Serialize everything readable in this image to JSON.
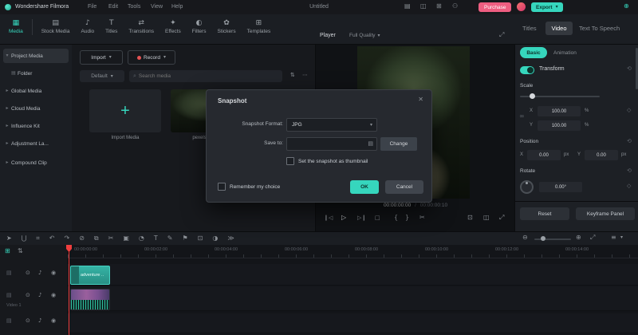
{
  "colors": {
    "accent": "#36d6bd",
    "purchase": "#ef5e81",
    "playhead": "#f03e3e"
  },
  "titlebar": {
    "app_name": "Wondershare Filmora",
    "menus": [
      "File",
      "Edit",
      "Tools",
      "View",
      "Help"
    ],
    "project_title": "Untitled",
    "purchase_label": "Purchase",
    "export_label": "Export",
    "export_caret": "▾",
    "icons": [
      {
        "name": "workspace-icon",
        "glyph": "▤"
      },
      {
        "name": "display-icon",
        "glyph": "◫"
      },
      {
        "name": "grid-icon",
        "glyph": "⊞"
      },
      {
        "name": "account-icon",
        "glyph": "⚇"
      }
    ],
    "add_icon": "⊕"
  },
  "ribbon": {
    "tabs": [
      {
        "label": "Media",
        "icon": "▦"
      },
      {
        "label": "Stock Media",
        "icon": "▤"
      },
      {
        "label": "Audio",
        "icon": "♪"
      },
      {
        "label": "Titles",
        "icon": "T"
      },
      {
        "label": "Transitions",
        "icon": "⇄"
      },
      {
        "label": "Effects",
        "icon": "✦"
      },
      {
        "label": "Filters",
        "icon": "◐"
      },
      {
        "label": "Stickers",
        "icon": "✿"
      },
      {
        "label": "Templates",
        "icon": "⊞"
      }
    ],
    "active_tab": "Media"
  },
  "sidebar": {
    "items": [
      {
        "label": "Project Media",
        "chevron": "▾"
      },
      {
        "label": "Folder",
        "chevron": ""
      },
      {
        "label": "Global Media",
        "chevron": "▸"
      },
      {
        "label": "Cloud Media",
        "chevron": "▸"
      },
      {
        "label": "Influence Kit",
        "chevron": "▸"
      },
      {
        "label": "Adjustment La...",
        "chevron": "▸"
      },
      {
        "label": "Compound Clip",
        "chevron": "▸"
      }
    ]
  },
  "media_panel": {
    "import_label": "Import",
    "record_label": "Record",
    "default_label": "Default",
    "caret": "▾",
    "search_placeholder": "Search media",
    "search_icon": "⌕",
    "sort_icon": "⇅",
    "more_icon": "⋯",
    "import_tile_plus": "+",
    "import_tile_label": "Import Media",
    "clip_label": "pexels-josh..."
  },
  "player": {
    "label": "Player",
    "quality": "Full Quality",
    "quality_caret": "▾",
    "expand_icon": "⤢",
    "timecode_current": "00:00:00:00",
    "timecode_divider": "/",
    "timecode_total": "00:00:00:10",
    "transport": [
      {
        "name": "skip-back",
        "glyph": "❙◁"
      },
      {
        "name": "play",
        "glyph": "▷"
      },
      {
        "name": "skip-forward",
        "glyph": "▷❙"
      },
      {
        "name": "stop",
        "glyph": "□"
      },
      {
        "name": "mark-in",
        "glyph": "{"
      },
      {
        "name": "mark-out",
        "glyph": "}"
      },
      {
        "name": "split",
        "glyph": "✂"
      },
      {
        "name": "snapshot",
        "glyph": "⊡"
      },
      {
        "name": "pip",
        "glyph": "◫"
      },
      {
        "name": "fullscreen",
        "glyph": "⤢"
      }
    ]
  },
  "dialog": {
    "title": "Snapshot",
    "close_icon": "✕",
    "format_label": "Snapshot Format:",
    "format_value": "JPG",
    "format_caret": "▾",
    "save_label": "Save to:",
    "save_value": "",
    "folder_icon": "▤",
    "change_label": "Change",
    "thumbnail_checkbox_label": "Set the snapshot as thumbnail",
    "thumbnail_checked": false,
    "remember_checkbox_label": "Remember my choice",
    "remember_checked": false,
    "ok_label": "OK",
    "cancel_label": "Cancel"
  },
  "properties": {
    "tabs": [
      "Titles",
      "Video",
      "Text To Speech"
    ],
    "active_tab": "Video",
    "subtabs": [
      "Basic",
      "Animation"
    ],
    "transform_label": "Transform",
    "section_reset_icon": "⟲",
    "keyframe_icon": "◇",
    "link_icon": "∞",
    "scale": {
      "label": "Scale",
      "x_label": "X",
      "x_value": "100.00",
      "y_label": "Y",
      "y_value": "100.00",
      "unit": "%"
    },
    "position": {
      "label": "Position",
      "x_label": "X",
      "x_value": "0.00",
      "y_label": "Y",
      "y_value": "0.00",
      "unit": "px"
    },
    "rotate": {
      "label": "Rotate",
      "value": "0.00°"
    },
    "reset_label": "Reset",
    "keyframe_panel_label": "Keyframe Panel"
  },
  "toolbar": {
    "icons": [
      {
        "name": "select",
        "glyph": "➤"
      },
      {
        "name": "magnet",
        "glyph": "⋃"
      },
      {
        "name": "snap",
        "glyph": "⌗"
      },
      {
        "name": "undo",
        "glyph": "↶"
      },
      {
        "name": "redo",
        "glyph": "↷"
      },
      {
        "name": "delete",
        "glyph": "⊘"
      },
      {
        "name": "duplicate",
        "glyph": "⧉"
      },
      {
        "name": "split",
        "glyph": "✂"
      },
      {
        "name": "crop",
        "glyph": "▣"
      },
      {
        "name": "speed",
        "glyph": "◔"
      },
      {
        "name": "text",
        "glyph": "T"
      },
      {
        "name": "pen",
        "glyph": "✎"
      },
      {
        "name": "marker",
        "glyph": "⚑"
      },
      {
        "name": "screen-record",
        "glyph": "⊡"
      },
      {
        "name": "chroma-key",
        "glyph": "◑"
      },
      {
        "name": "more-tools",
        "glyph": "≫"
      }
    ],
    "zoom_out_icon": "⊖",
    "zoom_in_icon": "⊕",
    "fit_icon": "⤢",
    "track_view_icon": "≡",
    "track_view_caret": "▾"
  },
  "timeline": {
    "manage_tracks_icon": "⊞",
    "mixer_icon": "⇅",
    "ruler": [
      "00:00:00:00",
      "00:00:02:00",
      "00:00:04:00",
      "00:00:06:00",
      "00:00:08:00",
      "00:00:10:00",
      "00:00:12:00",
      "00:00:14:00"
    ],
    "track_icons": [
      {
        "name": "toggle",
        "glyph": "⊙"
      },
      {
        "name": "mute",
        "glyph": "♪"
      },
      {
        "name": "hide",
        "glyph": "◉"
      }
    ],
    "track_type_icon": "▤",
    "track_label": "Video 1",
    "clips": [
      {
        "name": "adventure ..",
        "color": "#2fae9f"
      },
      {
        "name": "",
        "color": "#7a5090"
      }
    ]
  }
}
